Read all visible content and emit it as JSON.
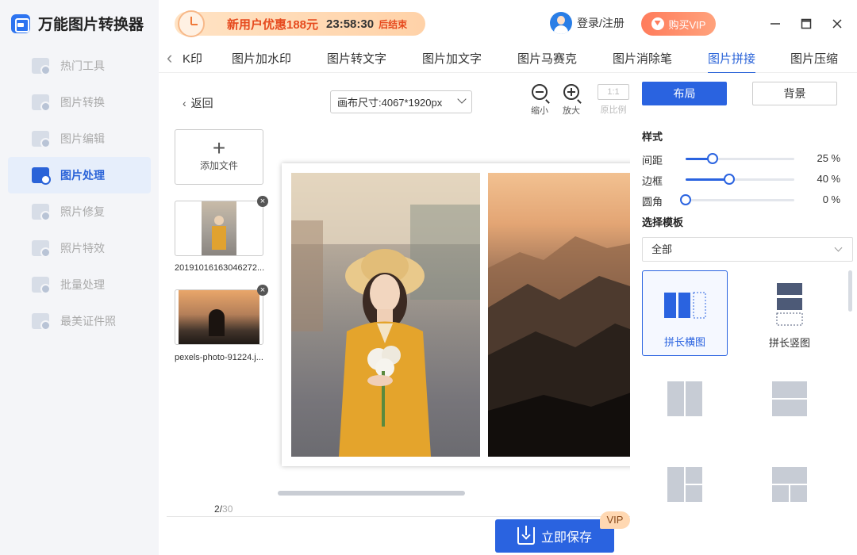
{
  "app": {
    "title": "万能图片转换器"
  },
  "sidebar": {
    "items": [
      {
        "label": "热门工具",
        "icon": "grid-icon"
      },
      {
        "label": "图片转换",
        "icon": "image-convert-icon"
      },
      {
        "label": "图片编辑",
        "icon": "image-edit-icon"
      },
      {
        "label": "图片处理",
        "icon": "image-process-icon",
        "active": true
      },
      {
        "label": "照片修复",
        "icon": "photo-repair-icon"
      },
      {
        "label": "照片特效",
        "icon": "photo-effect-icon"
      },
      {
        "label": "批量处理",
        "icon": "batch-icon"
      },
      {
        "label": "最美证件照",
        "icon": "id-photo-icon"
      }
    ]
  },
  "promo": {
    "title": "新用户优惠188元",
    "timer": "23:58:30",
    "end_label": "后结束"
  },
  "header": {
    "login_label": "登录/注册",
    "vip_label": "购买VIP"
  },
  "window": {
    "minimize": "—",
    "maximize": "☐",
    "close": "✕"
  },
  "tabs": [
    {
      "label": "K印"
    },
    {
      "label": "图片加水印"
    },
    {
      "label": "图片转文字"
    },
    {
      "label": "图片加文字"
    },
    {
      "label": "图片马赛克"
    },
    {
      "label": "图片消除笔"
    },
    {
      "label": "图片拼接",
      "active": true
    },
    {
      "label": "图片压缩"
    }
  ],
  "toolbar": {
    "back_label": "返回",
    "canvas_size": "画布尺寸:4067*1920px",
    "zoom_out_label": "缩小",
    "zoom_in_label": "放大",
    "ratio_button": "1:1",
    "ratio_label": "原比例"
  },
  "files": {
    "add_label": "添加文件",
    "items": [
      {
        "name": "20191016163046272..."
      },
      {
        "name": "pexels-photo-91224.j..."
      }
    ],
    "remove_glyph": "×"
  },
  "pagination": {
    "current": "2",
    "total": "30"
  },
  "save": {
    "label": "立即保存",
    "vip_tag": "VIP"
  },
  "panel": {
    "tab_layout": "布局",
    "tab_background": "背景",
    "style_title": "样式",
    "sliders": [
      {
        "label": "间距",
        "value": 25,
        "unit": "%"
      },
      {
        "label": "边框",
        "value": 40,
        "unit": "%"
      },
      {
        "label": "圆角",
        "value": 0,
        "unit": "%"
      }
    ],
    "template_title": "选择模板",
    "template_filter": "全部",
    "templates": [
      {
        "label": "拼长横图",
        "selected": true
      },
      {
        "label": "拼长竖图"
      },
      {
        "label": ""
      },
      {
        "label": ""
      },
      {
        "label": ""
      },
      {
        "label": ""
      }
    ]
  },
  "colors": {
    "accent": "#2A63E0",
    "promo": "#E64A1E",
    "vip": "#FF7C5C",
    "sidebar_bg": "#F4F5F8"
  }
}
